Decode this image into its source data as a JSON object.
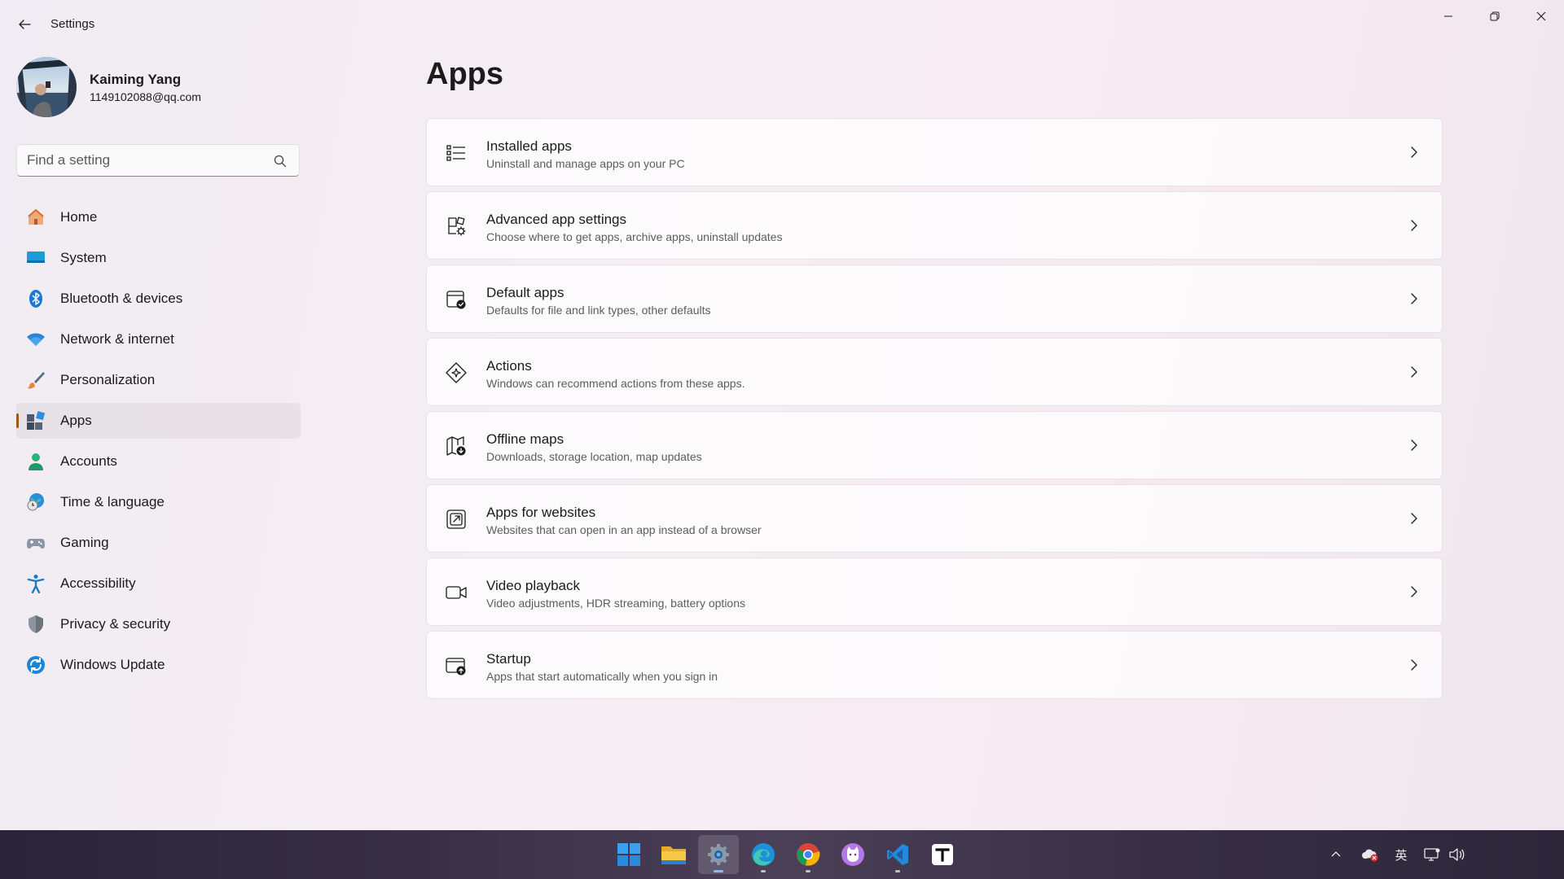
{
  "window": {
    "title": "Settings"
  },
  "profile": {
    "name": "Kaiming Yang",
    "email": "1149102088@qq.com"
  },
  "search": {
    "placeholder": "Find a setting"
  },
  "sidebar": {
    "items": [
      {
        "label": "Home",
        "icon": "home-icon",
        "active": false
      },
      {
        "label": "System",
        "icon": "system-icon",
        "active": false
      },
      {
        "label": "Bluetooth & devices",
        "icon": "bluetooth-icon",
        "active": false
      },
      {
        "label": "Network & internet",
        "icon": "wifi-icon",
        "active": false
      },
      {
        "label": "Personalization",
        "icon": "brush-icon",
        "active": false
      },
      {
        "label": "Apps",
        "icon": "apps-icon",
        "active": true
      },
      {
        "label": "Accounts",
        "icon": "accounts-icon",
        "active": false
      },
      {
        "label": "Time & language",
        "icon": "globe-clock-icon",
        "active": false
      },
      {
        "label": "Gaming",
        "icon": "gamepad-icon",
        "active": false
      },
      {
        "label": "Accessibility",
        "icon": "accessibility-icon",
        "active": false
      },
      {
        "label": "Privacy & security",
        "icon": "shield-icon",
        "active": false
      },
      {
        "label": "Windows Update",
        "icon": "update-icon",
        "active": false
      }
    ]
  },
  "main": {
    "title": "Apps",
    "cards": [
      {
        "title": "Installed apps",
        "desc": "Uninstall and manage apps on your PC",
        "icon": "list-icon"
      },
      {
        "title": "Advanced app settings",
        "desc": "Choose where to get apps, archive apps, uninstall updates",
        "icon": "app-gear-icon"
      },
      {
        "title": "Default apps",
        "desc": "Defaults for file and link types, other defaults",
        "icon": "default-apps-icon"
      },
      {
        "title": "Actions",
        "desc": "Windows can recommend actions from these apps.",
        "icon": "actions-icon"
      },
      {
        "title": "Offline maps",
        "desc": "Downloads, storage location, map updates",
        "icon": "map-icon"
      },
      {
        "title": "Apps for websites",
        "desc": "Websites that can open in an app instead of a browser",
        "icon": "open-external-icon"
      },
      {
        "title": "Video playback",
        "desc": "Video adjustments, HDR streaming, battery options",
        "icon": "video-icon"
      },
      {
        "title": "Startup",
        "desc": "Apps that start automatically when you sign in",
        "icon": "startup-icon"
      }
    ]
  },
  "taskbar": {
    "apps": [
      "start-icon",
      "file-explorer-icon",
      "settings-icon",
      "edge-icon",
      "chrome-icon",
      "cat-app-icon",
      "vscode-icon",
      "typora-icon"
    ],
    "tray": {
      "ime": "英"
    }
  },
  "colors": {
    "accent": "#0067c0",
    "nav_indicator": "#9a5b13"
  }
}
